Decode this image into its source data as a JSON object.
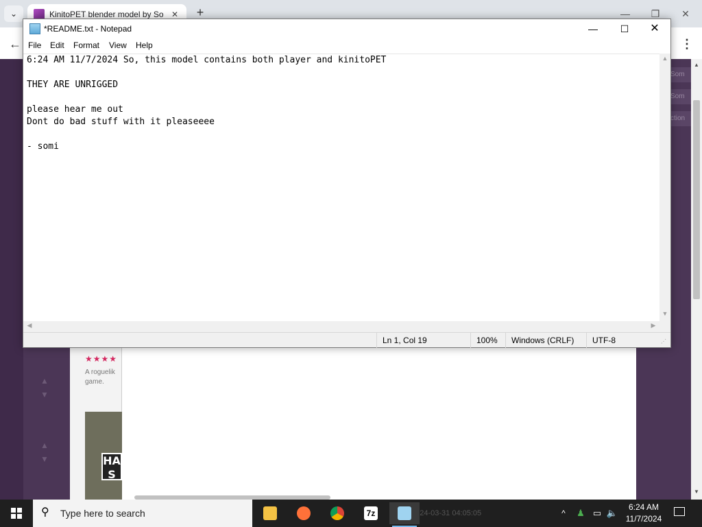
{
  "browser": {
    "tab_title": "KinitoPET blender model by So",
    "tab_close": "✕",
    "new_tab": "+",
    "minimize": "—",
    "maximize": "❐",
    "close": "✕",
    "back": "←",
    "menu": "⋮",
    "page": {
      "stars": "★★★★",
      "card_desc": "A roguelik game.",
      "thumb_label": "HA S",
      "side_items": [
        "Som",
        "Som",
        "ction"
      ]
    }
  },
  "notepad": {
    "title": "*README.txt - Notepad",
    "window_buttons": {
      "minimize": "—",
      "maximize": "☐",
      "close": "✕"
    },
    "menu": [
      "File",
      "Edit",
      "Format",
      "View",
      "Help"
    ],
    "content": "6:24 AM 11/7/2024 So, this model contains both player and kinitoPET\n\nTHEY ARE UNRIGGED\n\nplease hear me out\nDont do bad stuff with it pleaseeee\n\n- somi",
    "status": {
      "position": "Ln 1, Col 19",
      "zoom": "100%",
      "line_ending": "Windows (CRLF)",
      "encoding": "UTF-8"
    }
  },
  "taskbar": {
    "search_placeholder": "Type here to search",
    "apps": [
      {
        "name": "File Explorer",
        "icon": "folder-icon",
        "color": "#f4c244"
      },
      {
        "name": "Firefox",
        "icon": "firefox-icon",
        "color": "#ff7139"
      },
      {
        "name": "Chrome",
        "icon": "chrome-icon",
        "color": "#4285f4"
      },
      {
        "name": "7-Zip",
        "icon": "7zip-icon",
        "color": "#ffffff",
        "label": "7z"
      },
      {
        "name": "Notepad",
        "icon": "notepad-icon",
        "color": "#9fd3f0"
      }
    ],
    "ghost_text": "2024-03-31 04:05:05",
    "clock": {
      "time": "6:24 AM",
      "date": "11/7/2024"
    }
  }
}
